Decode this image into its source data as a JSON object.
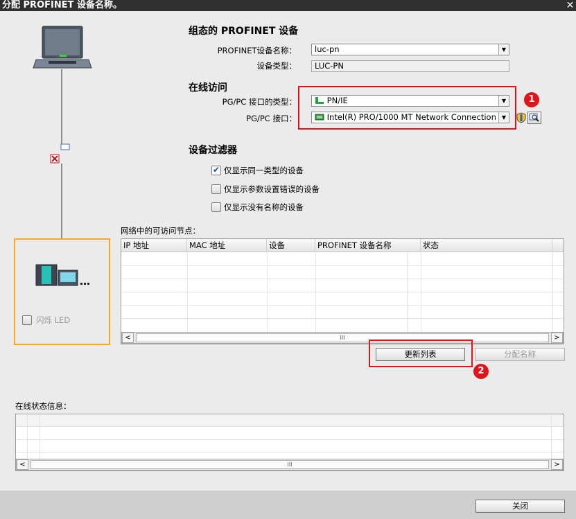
{
  "window": {
    "title": "分配 PROFINET 设备名称。",
    "close_label": "✕"
  },
  "configured_device": {
    "section_title": "组态的 PROFINET 设备",
    "name_label": "PROFINET设备名称：",
    "name_value": "luc-pn",
    "type_label": "设备类型：",
    "type_value": "LUC-PN"
  },
  "online_access": {
    "section_title": "在线访问",
    "pgpc_type_label": "PG/PC 接口的类型：",
    "pgpc_type_value": "PN/IE",
    "pgpc_iface_label": "PG/PC 接口：",
    "pgpc_iface_value": "Intel(R) PRO/1000 MT Network Connection",
    "annotation_1": "1"
  },
  "device_filter": {
    "section_title": "设备过滤器",
    "options": [
      {
        "label": "仅显示同一类型的设备",
        "checked": true
      },
      {
        "label": "仅显示参数设置错误的设备",
        "checked": false
      },
      {
        "label": "仅显示没有名称的设备",
        "checked": false
      }
    ]
  },
  "nodes": {
    "caption": "网络中的可访问节点：",
    "columns": [
      "IP 地址",
      "MAC 地址",
      "设备",
      "PROFINET 设备名称",
      "状态"
    ],
    "rows": [],
    "scroll_thumb": "III"
  },
  "buttons": {
    "update_list": "更新列表",
    "assign_name": "分配名称",
    "close": "关闭",
    "annotation_2": "2"
  },
  "left_panel": {
    "flash_led_label": "闪烁 LED",
    "flash_led_checked": false
  },
  "status_info": {
    "caption": "在线状态信息：",
    "scroll_thumb": "III"
  },
  "colors": {
    "annotation_red": "#e0151b",
    "highlight_orange": "#f5a623",
    "titlebar": "#2f2f2f"
  }
}
